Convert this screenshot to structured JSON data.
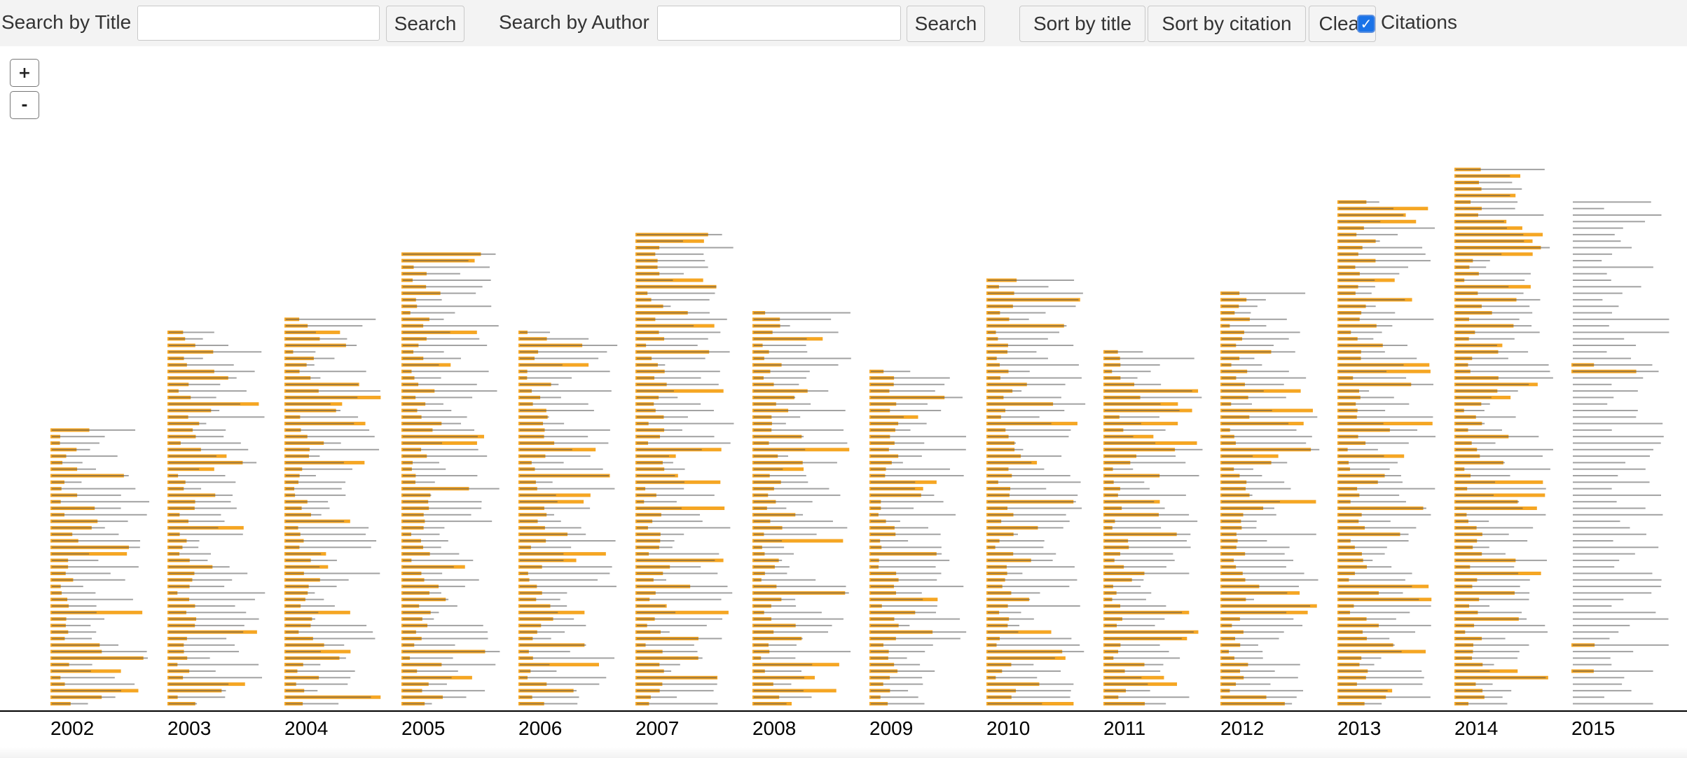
{
  "toolbar": {
    "title_search_label": "Search by Title",
    "title_search_value": "",
    "title_search_button": "Search",
    "author_search_label": "Search by Author",
    "author_search_value": "",
    "author_search_button": "Search",
    "sort_title_button": "Sort by title",
    "sort_citation_button": "Sort by citation",
    "clear_button": "Clear",
    "citations_checkbox_label": "Citations",
    "citations_checked": true
  },
  "zoom": {
    "in_label": "+",
    "out_label": "-"
  },
  "colors": {
    "citation_bar": "#f5a623",
    "paper_text": "#555555",
    "axis": "#000000"
  },
  "chart_data": {
    "type": "bar",
    "categories": [
      "2002",
      "2003",
      "2004",
      "2005",
      "2006",
      "2007",
      "2008",
      "2009",
      "2010",
      "2011",
      "2012",
      "2013",
      "2014",
      "2015"
    ],
    "values": [
      43,
      58,
      60,
      70,
      58,
      73,
      61,
      52,
      66,
      55,
      64,
      78,
      83,
      78
    ],
    "title": "",
    "xlabel": "",
    "ylabel": ""
  }
}
